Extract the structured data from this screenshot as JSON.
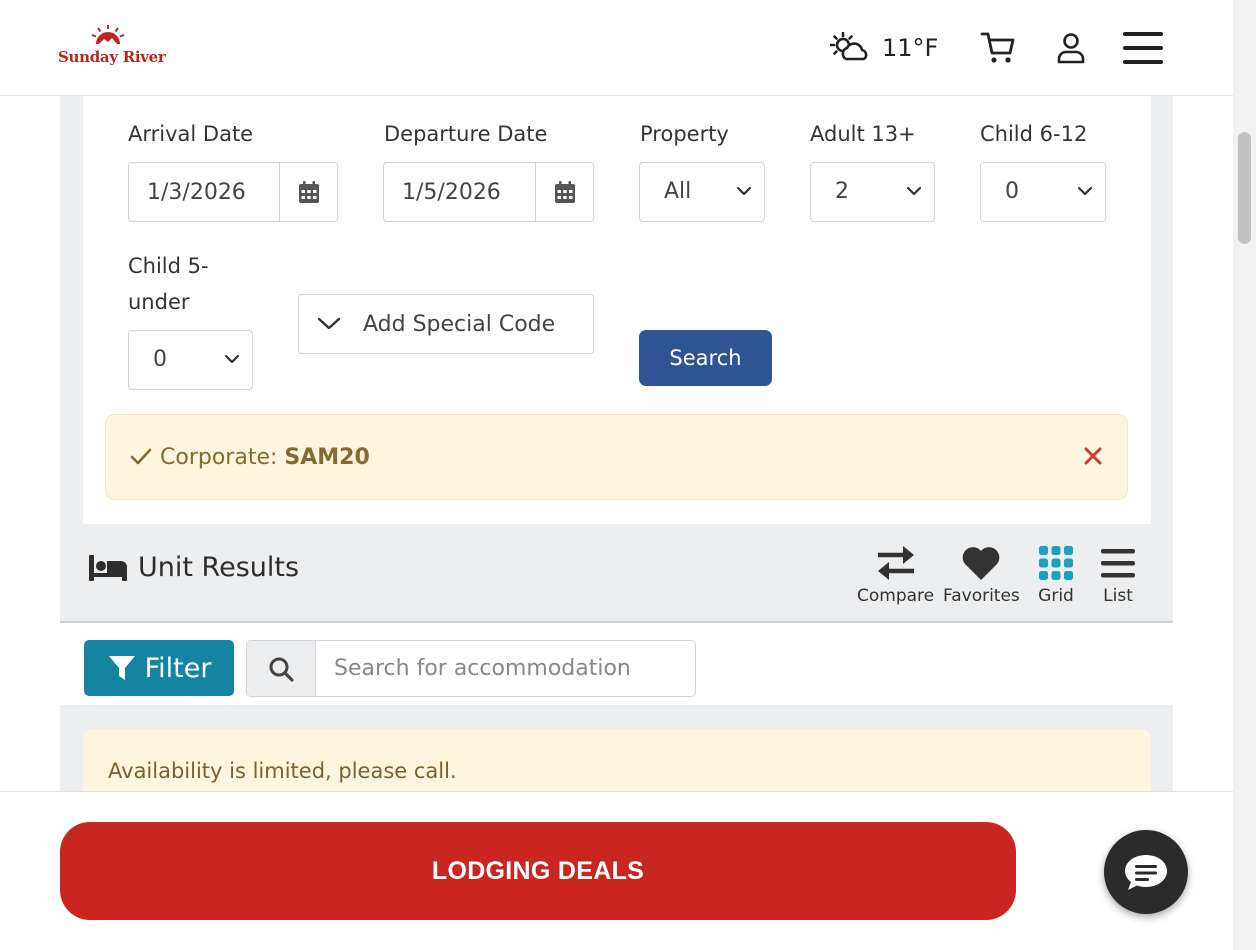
{
  "header": {
    "logo_text": "Sunday River",
    "weather_icon": "sun-cloud-icon",
    "temperature": "11°F",
    "cart_icon": "cart-icon",
    "account_icon": "user-icon",
    "menu_icon": "hamburger-menu-icon"
  },
  "search_form": {
    "arrival_label": "Arrival Date",
    "arrival_value": "1/3/2026",
    "departure_label": "Departure Date",
    "departure_value": "1/5/2026",
    "property_label": "Property",
    "property_value": "All",
    "adult_label": "Adult 13+",
    "adult_value": "2",
    "child612_label": "Child 6-12",
    "child612_value": "0",
    "child5_label_line1": "Child 5-",
    "child5_label_line2": "under",
    "child5_value": "0",
    "special_code_label": "Add Special Code",
    "search_label": "Search"
  },
  "promo": {
    "prefix": "Corporate:",
    "code": "SAM20"
  },
  "results": {
    "title": "Unit Results",
    "tools": [
      "Compare",
      "Favorites",
      "Grid",
      "List"
    ]
  },
  "filter": {
    "button_label": "Filter",
    "search_placeholder": "Search for accommodation"
  },
  "alert": {
    "text": "Availability is limited, please call."
  },
  "footer": {
    "deals_label": "LODGING DEALS",
    "chat_icon": "chat-bubble-icon"
  },
  "colors": {
    "brand_red": "#c8261f",
    "search_blue": "#2e5496",
    "filter_teal": "#1484a0",
    "grid_teal": "#1ba1c1",
    "promo_bg": "#fdf5dd"
  }
}
